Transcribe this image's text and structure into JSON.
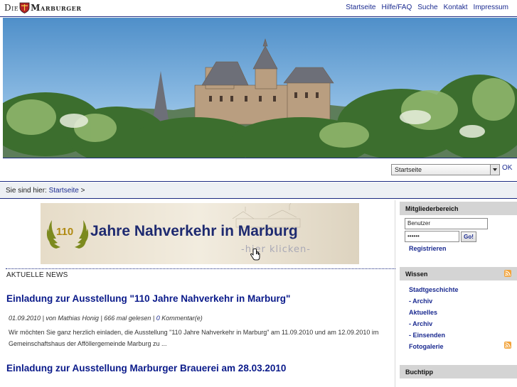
{
  "header": {
    "logo_prefix": "Die",
    "logo_name": "Marburger",
    "nav": [
      "Startseite",
      "Hilfe/FAQ",
      "Suche",
      "Kontakt",
      "Impressum"
    ]
  },
  "page_select": {
    "selected": "Startseite",
    "ok_label": "OK"
  },
  "breadcrumb": {
    "prefix": "Sie sind hier:",
    "link": "Startseite",
    "separator": ">"
  },
  "banner": {
    "number": "110",
    "title": "Jahre Nahverkehr in Marburg",
    "subtitle": "-hier klicken-"
  },
  "news": {
    "heading": "AKTUELLE NEWS",
    "articles": [
      {
        "title": "Einladung zur Ausstellung \"110 Jahre Nahverkehr in Marburg\"",
        "date": "01.09.2010",
        "author_part": "| von Mathias Honig | 666 mal gelesen |",
        "comment_count": "0",
        "comment_label": "Kommentar(e)",
        "text": "Wir möchten Sie ganz herzlich einladen, die Ausstellung \"110 Jahre Nahverkehr in Marburg\" am 11.09.2010 und am 12.09.2010 im Gemeinschaftshaus der Afföllergemeinde Marburg zu ..."
      },
      {
        "title": "Einladung zur Ausstellung Marburger Brauerei am 28.03.2010",
        "date": "",
        "author_part": "",
        "comment_count": "",
        "comment_label": "",
        "text": ""
      }
    ]
  },
  "sidebar": {
    "members": {
      "title": "Mitgliederbereich",
      "user_value": "Benutzer",
      "pass_value": "••••••",
      "go_label": "Go!",
      "register_label": "Registrieren"
    },
    "wissen": {
      "title": "Wissen",
      "links": [
        "Stadtgeschichte",
        "- Archiv",
        "Aktuelles",
        "- Archiv",
        "- Einsenden",
        "Fotogalerie"
      ]
    },
    "buchtipp": {
      "title": "Buchtipp"
    }
  },
  "colors": {
    "link": "#1a2a90",
    "title": "#0a1a8a",
    "rule": "#1b2a80",
    "sidebar_header": "#d4d4d4",
    "rss": "#f2a33a"
  }
}
